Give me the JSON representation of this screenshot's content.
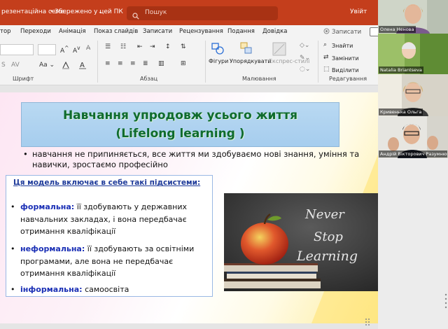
{
  "titlebar": {
    "doc_name": "резентаційна семе...",
    "save_status": "Збережено у цей ПК",
    "search_placeholder": "Пошук",
    "signin_label": "Увійт"
  },
  "menu": {
    "items": [
      "тор",
      "Переходи",
      "Анімація",
      "Показ слайдів",
      "Записати",
      "Рецензування",
      "Подання",
      "Довідка"
    ],
    "publish_label": "Записати"
  },
  "ribbon": {
    "groups": [
      "Шрифт",
      "Абзац",
      "Малювання",
      "Редагування"
    ],
    "shapes_label": "Фігури",
    "arrange_label": "Упорядкувати",
    "quick_styles_label": "Експрес-стилі",
    "find_label": "Знайти",
    "replace_label": "Замінити",
    "select_label": "Виділити"
  },
  "slide": {
    "title_line1": "Навчання упродовж усього життя",
    "title_line2": "(Lifelong learning )",
    "main_bullet": "навчання не припиняється, все життя ми здобуваємо нові знання, уміння та навички, зростаємо професійно",
    "subsystems_heading": "Ця модель включає в себе такі підсистеми:",
    "items": [
      {
        "term": "формальна:",
        "text": " її здобувають у державних навчальних закладах, і вона передбачає отримання кваліфікації"
      },
      {
        "term": "неформальна:",
        "text": " її здобувають за освітніми програмами, але вона не передбачає отримання кваліфікації"
      },
      {
        "term": "інформальна:",
        "text": " самоосвіта"
      }
    ],
    "image_words": [
      "Never",
      "Stop",
      "Learning"
    ]
  },
  "participants": [
    {
      "name": "Олена Ненова"
    },
    {
      "name": "Natalia Briantseva"
    },
    {
      "name": "Кривенька Ольга"
    },
    {
      "name": "Андрій Вікторович Разумнюк"
    }
  ],
  "colors": {
    "titlebar": "#c43e1c",
    "slide_title": "#0f6b2e",
    "keyword": "#1a2fb5"
  }
}
